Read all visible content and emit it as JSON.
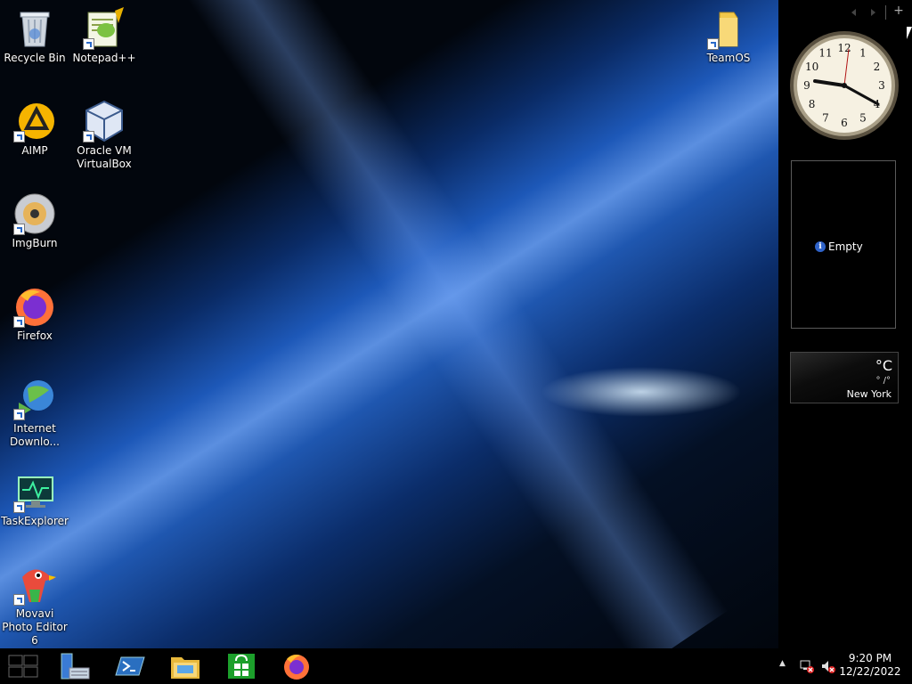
{
  "desktop": {
    "icons": [
      {
        "label": "Recycle Bin"
      },
      {
        "label": "Notepad++"
      },
      {
        "label": "TeamOS"
      },
      {
        "label": "AIMP"
      },
      {
        "label": "Oracle VM VirtualBox"
      },
      {
        "label": "ImgBurn"
      },
      {
        "label": "Firefox"
      },
      {
        "label": "Internet Downlo..."
      },
      {
        "label": "TaskExplorer"
      },
      {
        "label": "Movavi Photo Editor 6"
      }
    ]
  },
  "gadgets": {
    "clock": {
      "numerals": [
        "12",
        "1",
        "2",
        "3",
        "4",
        "5",
        "6",
        "7",
        "8",
        "9",
        "10",
        "11"
      ]
    },
    "slideshow": {
      "status": "Empty",
      "info_icon": "info-icon"
    },
    "weather": {
      "temp_unit": "°C",
      "range": "° /°",
      "city": "New York"
    },
    "sidebar_controls": {
      "add": "+"
    }
  },
  "taskbar": {
    "time": "9:20 PM",
    "date": "12/22/2022",
    "icons": [
      "start-icon",
      "server-manager-icon",
      "powershell-icon",
      "file-explorer-icon",
      "store-icon",
      "firefox-icon"
    ],
    "tray_icons": [
      "show-hidden-icons",
      "network-icon",
      "volume-muted-icon"
    ],
    "tray_chevron": "▲"
  },
  "colors": {
    "taskbar": "#000000",
    "wallpaper_accent": "#1d58b8",
    "store_green": "#1c9f2b"
  }
}
